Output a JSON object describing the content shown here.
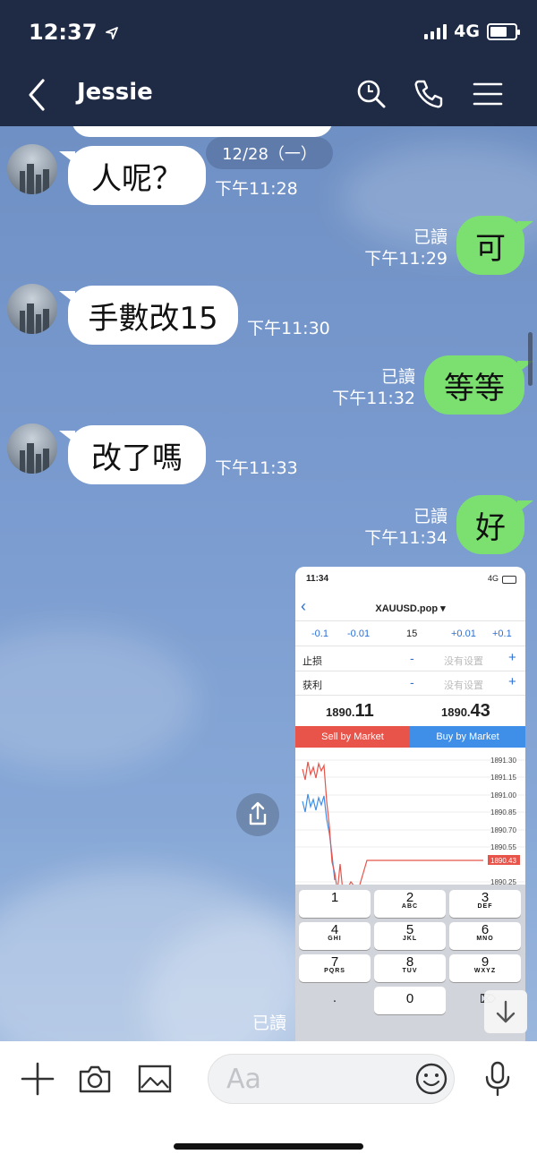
{
  "status_bar": {
    "time": "12:37",
    "network": "4G"
  },
  "header": {
    "contact_name": "Jessie"
  },
  "date_separator": "12/28（一）",
  "messages": [
    {
      "from": "contact",
      "text": "人呢？",
      "time": "下午11:28"
    },
    {
      "from": "me",
      "text": "可",
      "read": "已讀",
      "time": "下午11:29"
    },
    {
      "from": "contact",
      "text": "手數改15",
      "time": "下午11:30"
    },
    {
      "from": "me",
      "text": "等等",
      "read": "已讀",
      "time": "下午11:32"
    },
    {
      "from": "contact",
      "text": "改了嗎",
      "time": "下午11:33"
    },
    {
      "from": "me",
      "text": "好",
      "read": "已讀",
      "time": "下午11:34"
    },
    {
      "from": "me",
      "type": "image",
      "read": "已讀"
    }
  ],
  "image_message": {
    "time": "11:34",
    "network": "4G",
    "symbol": "XAUUSD.pop",
    "steps": [
      "-0.1",
      "-0.01",
      "15",
      "+0.01",
      "+0.1"
    ],
    "stop_loss_label": "止损",
    "take_profit_label": "获利",
    "not_set": "没有设置",
    "minus": "-",
    "plus": "+",
    "sell_price_small": "1890.",
    "sell_price_big": "11",
    "buy_price_small": "1890.",
    "buy_price_big": "43",
    "sell_label": "Sell by Market",
    "buy_label": "Buy by Market",
    "chart_axis": [
      "1891.30",
      "1891.15",
      "1891.00",
      "1890.85",
      "1890.70",
      "1890.55",
      "1890.43",
      "1890.25"
    ],
    "keypad": [
      {
        "n": "1",
        "l": ""
      },
      {
        "n": "2",
        "l": "ABC"
      },
      {
        "n": "3",
        "l": "DEF"
      },
      {
        "n": "4",
        "l": "GHI"
      },
      {
        "n": "5",
        "l": "JKL"
      },
      {
        "n": "6",
        "l": "MNO"
      },
      {
        "n": "7",
        "l": "PQRS"
      },
      {
        "n": "8",
        "l": "TUV"
      },
      {
        "n": "9",
        "l": "WXYZ"
      },
      {
        "n": ".",
        "l": ""
      },
      {
        "n": "0",
        "l": ""
      }
    ]
  },
  "composer": {
    "placeholder": "Aa"
  },
  "colors": {
    "header_bg": "#1f2a44",
    "my_bubble": "#7be070",
    "their_bubble": "#ffffff",
    "sell": "#e8534a",
    "buy": "#3f8ee8"
  },
  "icons": [
    "back-icon",
    "search-icon",
    "phone-icon",
    "menu-icon",
    "share-icon",
    "scroll-down-icon",
    "plus-icon",
    "camera-icon",
    "image-icon",
    "emoji-icon",
    "mic-icon"
  ]
}
